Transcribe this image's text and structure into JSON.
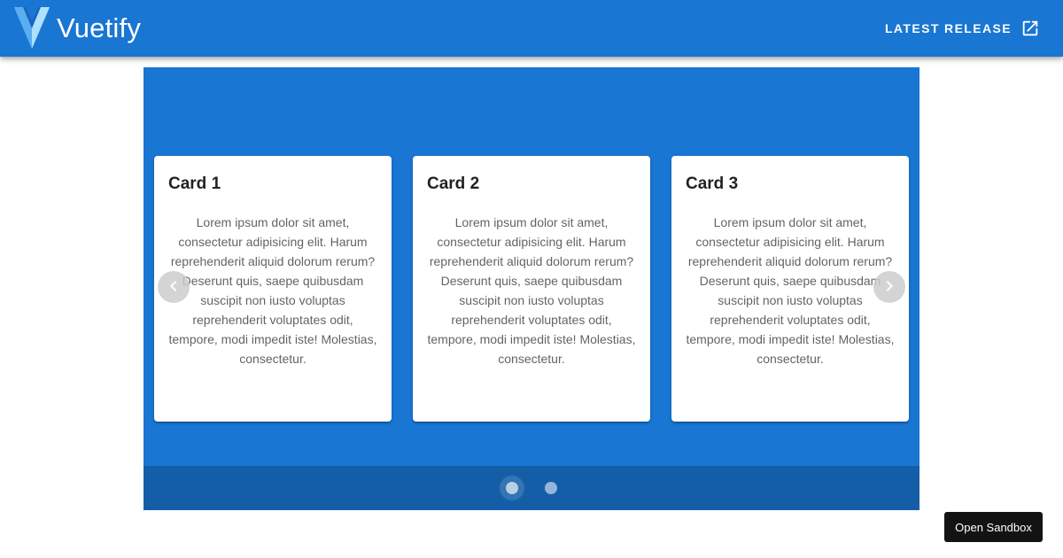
{
  "header": {
    "brand_name": "Vuetify",
    "logo_icon": "vuetify-logo-icon",
    "release_label": "Latest Release",
    "release_icon": "open-in-new-icon",
    "bar_color": "#1976d2"
  },
  "carousel": {
    "background_color": "#1976d2",
    "prev_icon": "chevron-left-icon",
    "next_icon": "chevron-right-icon",
    "active_slide": 1,
    "slide_count": 2,
    "cards": [
      {
        "title": "Card 1",
        "text": "Lorem ipsum dolor sit amet, consectetur adipisicing elit. Harum reprehenderit aliquid dolorum rerum? Deserunt quis, saepe quibusdam suscipit non iusto voluptas reprehenderit voluptates odit, tempore, modi impedit iste! Molestias, consectetur."
      },
      {
        "title": "Card 2",
        "text": "Lorem ipsum dolor sit amet, consectetur adipisicing elit. Harum reprehenderit aliquid dolorum rerum? Deserunt quis, saepe quibusdam suscipit non iusto voluptas reprehenderit voluptates odit, tempore, modi impedit iste! Molestias, consectetur."
      },
      {
        "title": "Card 3",
        "text": "Lorem ipsum dolor sit amet, consectetur adipisicing elit. Harum reprehenderit aliquid dolorum rerum? Deserunt quis, saepe quibusdam suscipit non iusto voluptas reprehenderit voluptates odit, tempore, modi impedit iste! Molestias, consectetur."
      }
    ]
  },
  "sandbox": {
    "label": "Open Sandbox"
  }
}
